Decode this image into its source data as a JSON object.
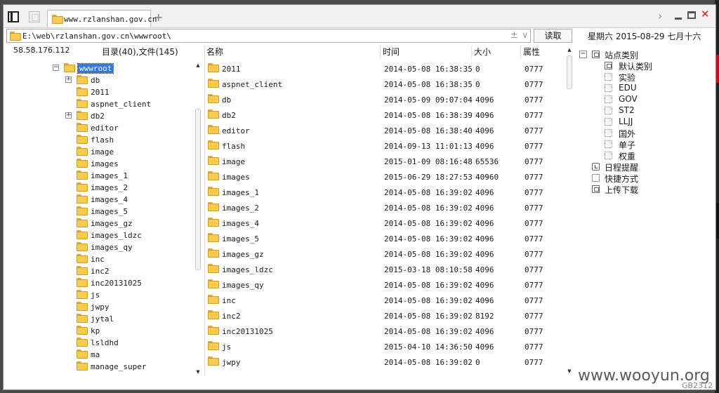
{
  "window": {
    "tab_title": "www.rzlanshan.gov.cn",
    "tab_add": "+",
    "close_glyph": "✕",
    "chevron_glyph": "›"
  },
  "address_bar": {
    "path": "E:\\web\\rzlanshan.gov.cn\\wwwroot\\",
    "plus": "±",
    "dropdown": "∨",
    "read_button": "读取"
  },
  "date_text": "星期六 2015-08-29 七月十六",
  "left_panel": {
    "ip": "58.58.176.112",
    "summary": "目录(40),文件(145)",
    "tree": [
      {
        "label": "wwwroot",
        "level": 0,
        "expander": "−",
        "selected": true
      },
      {
        "label": "db",
        "level": 1,
        "expander": "+"
      },
      {
        "label": "2011",
        "level": 1
      },
      {
        "label": "aspnet_client",
        "level": 1
      },
      {
        "label": "db2",
        "level": 1,
        "expander": "+"
      },
      {
        "label": "editor",
        "level": 1
      },
      {
        "label": "flash",
        "level": 1
      },
      {
        "label": "image",
        "level": 1
      },
      {
        "label": "images",
        "level": 1
      },
      {
        "label": "images_1",
        "level": 1
      },
      {
        "label": "images_2",
        "level": 1
      },
      {
        "label": "images_4",
        "level": 1
      },
      {
        "label": "images_5",
        "level": 1
      },
      {
        "label": "images_gz",
        "level": 1
      },
      {
        "label": "images_ldzc",
        "level": 1
      },
      {
        "label": "images_qy",
        "level": 1
      },
      {
        "label": "inc",
        "level": 1
      },
      {
        "label": "inc2",
        "level": 1
      },
      {
        "label": "inc20131025",
        "level": 1
      },
      {
        "label": "js",
        "level": 1
      },
      {
        "label": "jwpy",
        "level": 1
      },
      {
        "label": "jytal",
        "level": 1
      },
      {
        "label": "kp",
        "level": 1
      },
      {
        "label": "lsldhd",
        "level": 1
      },
      {
        "label": "ma",
        "level": 1
      },
      {
        "label": "manage_super",
        "level": 1
      }
    ]
  },
  "file_list": {
    "columns": {
      "name": "名称",
      "time": "时间",
      "size": "大小",
      "attr": "属性"
    },
    "rows": [
      {
        "name": "2011",
        "time": "2014-05-08 16:38:35",
        "size": "0",
        "attr": "0777"
      },
      {
        "name": "aspnet_client",
        "time": "2014-05-08 16:38:35",
        "size": "0",
        "attr": "0777"
      },
      {
        "name": "db",
        "time": "2014-05-09 09:07:04",
        "size": "4096",
        "attr": "0777"
      },
      {
        "name": "db2",
        "time": "2014-05-08 16:38:39",
        "size": "4096",
        "attr": "0777"
      },
      {
        "name": "editor",
        "time": "2014-05-08 16:38:40",
        "size": "4096",
        "attr": "0777"
      },
      {
        "name": "flash",
        "time": "2014-09-13 11:01:13",
        "size": "4096",
        "attr": "0777"
      },
      {
        "name": "image",
        "time": "2015-01-09 08:16:48",
        "size": "65536",
        "attr": "0777"
      },
      {
        "name": "images",
        "time": "2015-06-29 18:27:53",
        "size": "40960",
        "attr": "0777"
      },
      {
        "name": "images_1",
        "time": "2014-05-08 16:39:02",
        "size": "4096",
        "attr": "0777"
      },
      {
        "name": "images_2",
        "time": "2014-05-08 16:39:02",
        "size": "4096",
        "attr": "0777"
      },
      {
        "name": "images_4",
        "time": "2014-05-08 16:39:02",
        "size": "4096",
        "attr": "0777"
      },
      {
        "name": "images_5",
        "time": "2014-05-08 16:39:02",
        "size": "4096",
        "attr": "0777"
      },
      {
        "name": "images_gz",
        "time": "2014-05-08 16:39:02",
        "size": "4096",
        "attr": "0777"
      },
      {
        "name": "images_ldzc",
        "time": "2015-03-18 08:10:58",
        "size": "4096",
        "attr": "0777"
      },
      {
        "name": "images_qy",
        "time": "2014-05-08 16:39:02",
        "size": "4096",
        "attr": "0777"
      },
      {
        "name": "inc",
        "time": "2014-05-08 16:39:02",
        "size": "4096",
        "attr": "0777"
      },
      {
        "name": "inc2",
        "time": "2014-05-08 16:39:02",
        "size": "8192",
        "attr": "0777"
      },
      {
        "name": "inc20131025",
        "time": "2014-05-08 16:39:02",
        "size": "4096",
        "attr": "0777"
      },
      {
        "name": "js",
        "time": "2015-04-10 14:36:50",
        "size": "4096",
        "attr": "0777"
      },
      {
        "name": "jwpy",
        "time": "2014-05-08 16:39:02",
        "size": "0",
        "attr": "0777"
      }
    ]
  },
  "right_panel": {
    "items": [
      {
        "label": "站点类别",
        "icon": "collapse",
        "level": 0
      },
      {
        "label": "默认类别",
        "icon": "category",
        "level": 1
      },
      {
        "label": "实验",
        "icon": "category-dotted",
        "level": 1
      },
      {
        "label": "EDU",
        "icon": "category-dotted",
        "level": 1
      },
      {
        "label": "GOV",
        "icon": "category-dotted",
        "level": 1
      },
      {
        "label": "ST2",
        "icon": "category-dotted",
        "level": 1
      },
      {
        "label": "LLJJ",
        "icon": "category-dotted",
        "level": 1
      },
      {
        "label": "国外",
        "icon": "category-dotted",
        "level": 1
      },
      {
        "label": "单子",
        "icon": "category-dotted",
        "level": 1
      },
      {
        "label": "权重",
        "icon": "category-dotted",
        "level": 1
      },
      {
        "label": "日程提醒",
        "icon": "clock",
        "level": 0
      },
      {
        "label": "快捷方式",
        "icon": "hand",
        "level": 0
      },
      {
        "label": "上传下载",
        "icon": "upload",
        "level": 0
      }
    ]
  },
  "watermark": "www.wooyun.org",
  "encoding": "GB2312"
}
